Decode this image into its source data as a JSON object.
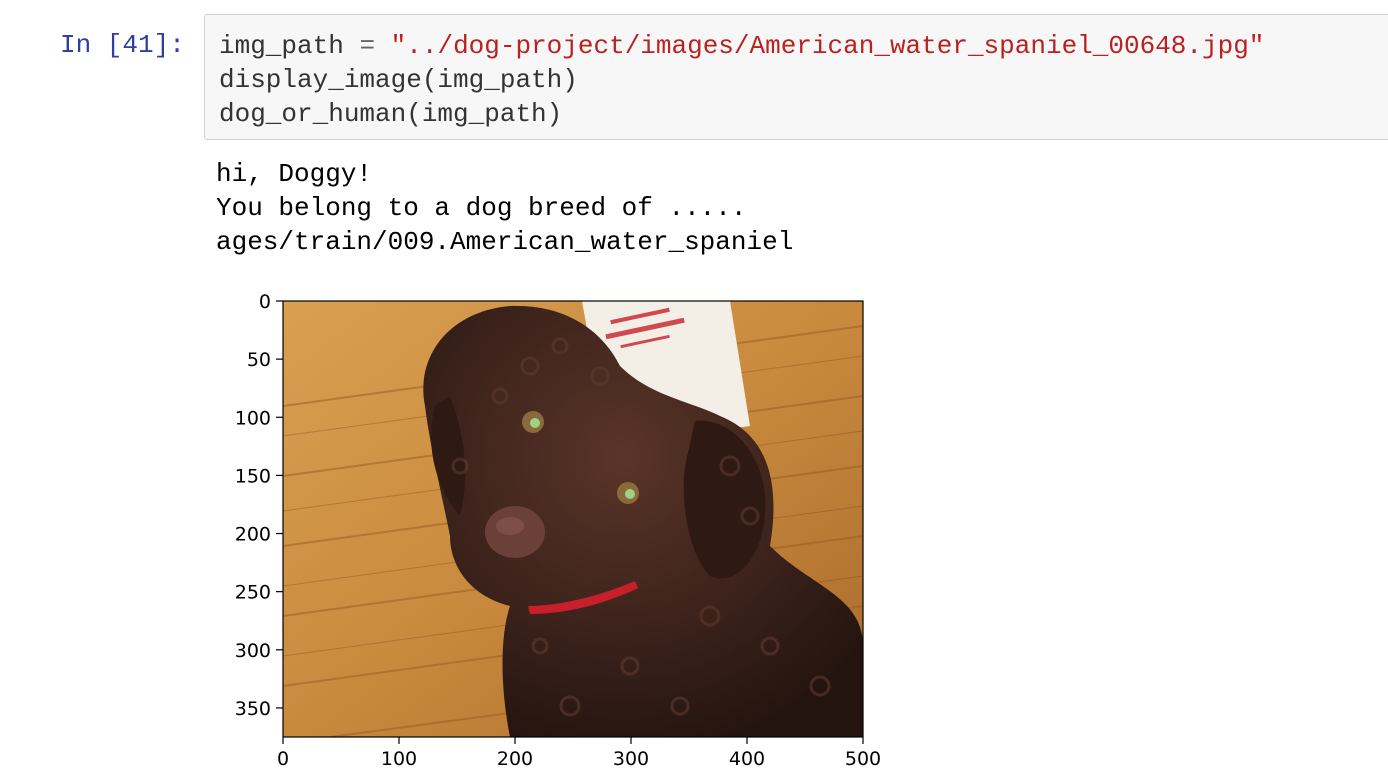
{
  "cell": {
    "prompt": "In [41]:",
    "code_lines": [
      [
        {
          "text": "img_path ",
          "cls": ""
        },
        {
          "text": "=",
          "cls": "tok-op"
        },
        {
          "text": " ",
          "cls": ""
        },
        {
          "text": "\"../dog-project/images/American_water_spaniel_00648.jpg\"",
          "cls": "tok-str"
        }
      ],
      [
        {
          "text": "display_image(img_path)",
          "cls": ""
        }
      ],
      [
        {
          "text": "dog_or_human(img_path)",
          "cls": ""
        }
      ]
    ]
  },
  "output": {
    "lines": [
      "hi, Doggy!",
      "You belong to a dog breed of .....",
      "ages/train/009.American_water_spaniel"
    ]
  },
  "figure": {
    "x_ticks": [
      0,
      100,
      200,
      300,
      400,
      500
    ],
    "y_ticks": [
      0,
      50,
      100,
      150,
      200,
      250,
      300,
      350
    ],
    "x_range": [
      0,
      500
    ],
    "y_range": [
      0,
      375
    ],
    "image_subject": "brown curly-coated dog on a wooden floor",
    "colors": {
      "floor": "#c98a3e",
      "dog": "#3b221b",
      "collar": "#c8202a",
      "axis": "#000000"
    }
  }
}
